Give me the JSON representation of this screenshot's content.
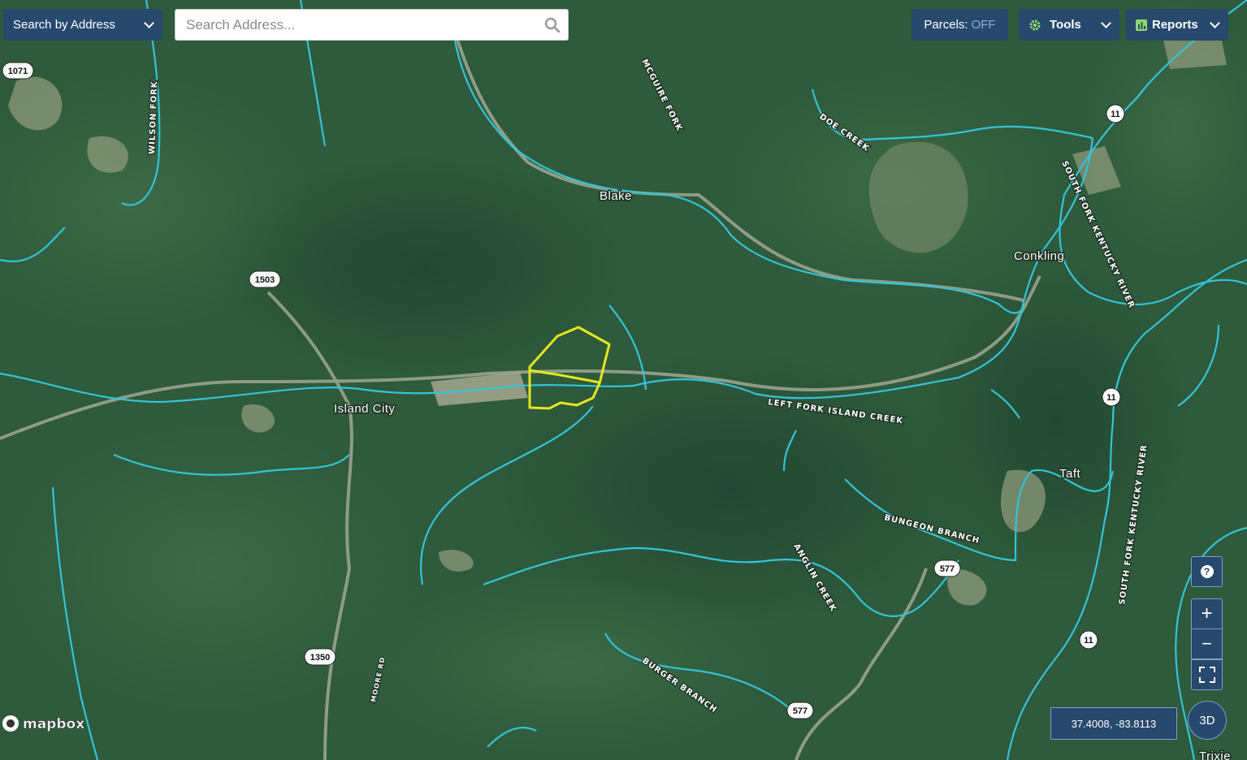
{
  "header": {
    "search_mode_label": "Search by Address",
    "search_placeholder": "Search Address...",
    "parcels_label": "Parcels:",
    "parcels_state": "OFF",
    "tools_label": "Tools",
    "reports_label": "Reports"
  },
  "map": {
    "attribution": "mapbox",
    "coordinates": "37.4008, -83.8113",
    "view_3d_label": "3D",
    "zoom_in_label": "+",
    "zoom_out_label": "−",
    "help_label": "?",
    "colors": {
      "water": "#33c4d8",
      "parcel_outline": "#e6e61e",
      "controls": "#27496d"
    },
    "places": [
      "Island City",
      "Blake",
      "Conkling",
      "Taft",
      "Trixie"
    ],
    "streams": [
      "WILSON FORK",
      "MCGUIRE FORK",
      "DOE CREEK",
      "SOUTH FORK KENTUCKY RIVER",
      "LEFT FORK ISLAND CREEK",
      "BUNGEON BRANCH",
      "ANGLIN CREEK",
      "BURGER BRANCH",
      "MOORE RD",
      "SOUTH FORK KENTUCKY RIVER"
    ],
    "route_shields": [
      "1071",
      "1503",
      "11",
      "11",
      "11",
      "577",
      "577",
      "1350"
    ]
  }
}
